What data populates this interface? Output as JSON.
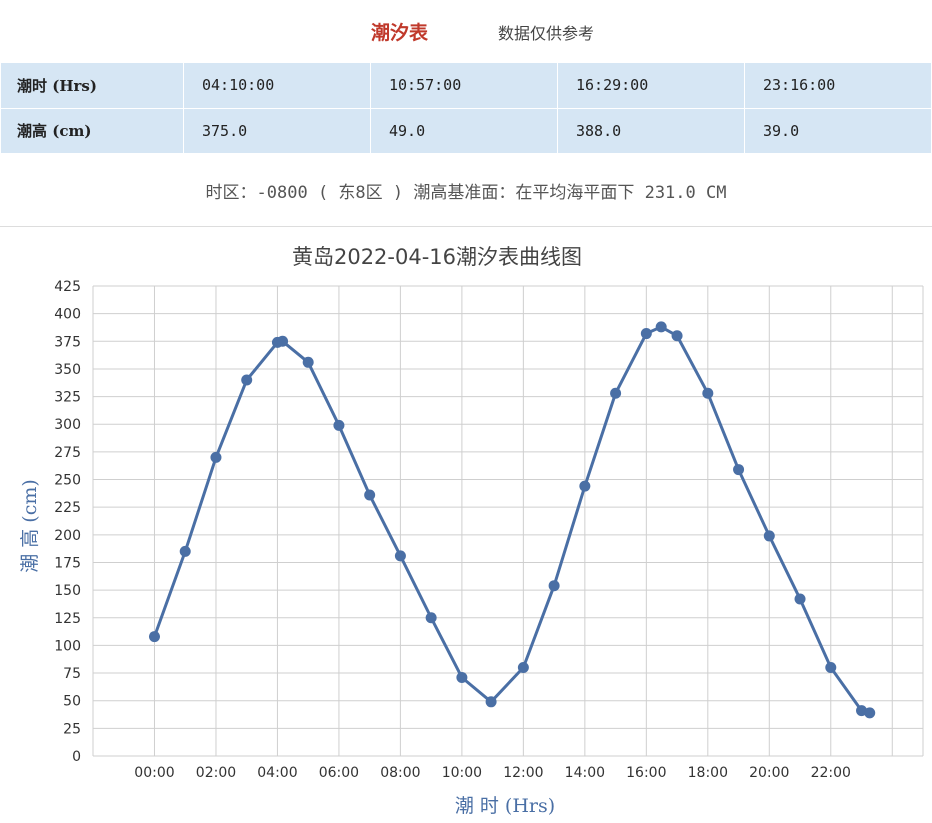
{
  "header": {
    "title": "潮汐表",
    "note": "数据仅供参考"
  },
  "table": {
    "rows": [
      {
        "label": "潮时 (Hrs)",
        "cells": [
          "04:10:00",
          "10:57:00",
          "16:29:00",
          "23:16:00"
        ]
      },
      {
        "label": "潮高 (cm)",
        "cells": [
          "375.0",
          "49.0",
          "388.0",
          "39.0"
        ]
      }
    ]
  },
  "timezone_line": "时区：-0800 ( 东8区 ) 潮高基准面：在平均海平面下 231.0 CM",
  "chart_data": {
    "type": "line",
    "title": "黄岛2022-04-16潮汐表曲线图",
    "xlabel": "潮 时 (Hrs)",
    "ylabel": "潮 高 (cm)",
    "x_ticks": [
      "00:00",
      "02:00",
      "04:00",
      "06:00",
      "08:00",
      "10:00",
      "12:00",
      "14:00",
      "16:00",
      "18:00",
      "20:00",
      "22:00"
    ],
    "xlim_hours": [
      -2,
      25
    ],
    "ylim": [
      0,
      425
    ],
    "y_ticks": [
      0,
      25,
      50,
      75,
      100,
      125,
      150,
      175,
      200,
      225,
      250,
      275,
      300,
      325,
      350,
      375,
      400,
      425
    ],
    "grid": true,
    "color": "#4a6fa5",
    "series": [
      {
        "x": [
          "00:00",
          "01:00",
          "02:00",
          "03:00",
          "04:00",
          "04:10",
          "05:00",
          "06:00",
          "07:00",
          "08:00",
          "09:00",
          "10:00",
          "10:57",
          "12:00",
          "13:00",
          "14:00",
          "15:00",
          "16:00",
          "16:29",
          "17:00",
          "18:00",
          "19:00",
          "20:00",
          "21:00",
          "22:00",
          "23:00",
          "23:16"
        ],
        "values": [
          108,
          185,
          270,
          340,
          374,
          375,
          356,
          299,
          236,
          181,
          125,
          71,
          49,
          80,
          154,
          244,
          328,
          382,
          388,
          380,
          328,
          259,
          199,
          142,
          80,
          41,
          39
        ]
      }
    ]
  }
}
